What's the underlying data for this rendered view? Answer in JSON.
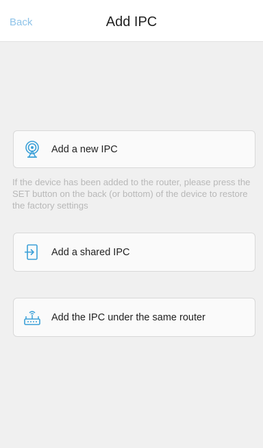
{
  "header": {
    "back_label": "Back",
    "title": "Add IPC"
  },
  "options": [
    {
      "label": "Add a new IPC",
      "icon": "camera-signal-icon"
    },
    {
      "label": "Add a shared IPC",
      "icon": "import-arrow-icon"
    },
    {
      "label": "Add the IPC under the same router",
      "icon": "router-icon"
    }
  ],
  "hint": "If the device has been added to the router, please press the SET button on the back (or bottom) of the device to restore the factory settings",
  "colors": {
    "accent": "#3aa0d8",
    "back_link": "#8ec3e9",
    "background": "#f0f0f0",
    "hint_text": "#b8b8b8"
  }
}
